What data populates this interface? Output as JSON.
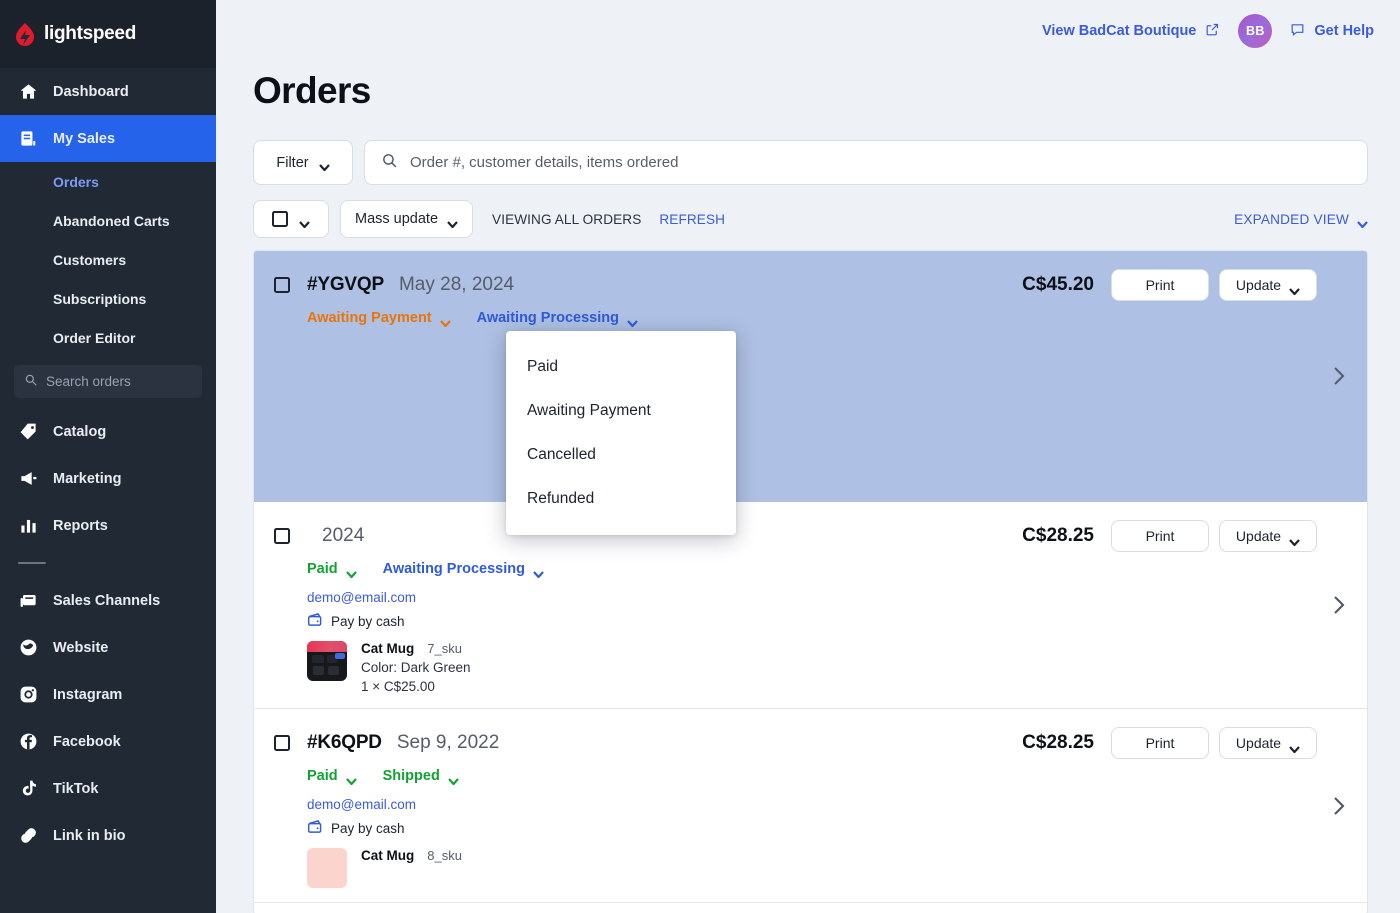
{
  "brand": {
    "name": "lightspeed",
    "logo_icon": "lightspeed-flame-icon"
  },
  "sidebar": {
    "primary": [
      {
        "label": "Dashboard",
        "icon": "home-icon",
        "active": false
      },
      {
        "label": "My Sales",
        "icon": "sales-document-icon",
        "active": true
      }
    ],
    "subnav": [
      {
        "label": "Orders",
        "current": true
      },
      {
        "label": "Abandoned Carts",
        "current": false
      },
      {
        "label": "Customers",
        "current": false
      },
      {
        "label": "Subscriptions",
        "current": false
      },
      {
        "label": "Order Editor",
        "current": false
      }
    ],
    "search_placeholder": "Search orders",
    "secondary": [
      {
        "label": "Catalog",
        "icon": "tag-icon"
      },
      {
        "label": "Marketing",
        "icon": "megaphone-icon"
      },
      {
        "label": "Reports",
        "icon": "bar-chart-icon"
      }
    ],
    "channels": [
      {
        "label": "Sales Channels",
        "icon": "storefront-icon"
      },
      {
        "label": "Website",
        "icon": "globe-icon"
      },
      {
        "label": "Instagram",
        "icon": "instagram-icon"
      },
      {
        "label": "Facebook",
        "icon": "facebook-icon"
      },
      {
        "label": "TikTok",
        "icon": "tiktok-icon"
      },
      {
        "label": "Link in bio",
        "icon": "link-icon"
      }
    ]
  },
  "topbar": {
    "view_store_label": "View BadCat Boutique",
    "view_store_icon": "external-link-icon",
    "avatar_initials": "BB",
    "help_label": "Get Help",
    "help_icon": "chat-bubble-icon"
  },
  "header": {
    "title": "Orders"
  },
  "toolbar": {
    "filter_label": "Filter",
    "search_placeholder": "Order #, customer details, items ordered",
    "search_value": "",
    "search_icon": "search-icon",
    "mass_update_label": "Mass update",
    "viewing_text": "VIEWING ALL ORDERS",
    "refresh_label": "REFRESH",
    "expanded_view_label": "EXPANDED VIEW"
  },
  "payment_status_dropdown": {
    "open": true,
    "options": [
      "Paid",
      "Awaiting Payment",
      "Cancelled",
      "Refunded"
    ]
  },
  "orders": [
    {
      "number": "#YGVQP",
      "date": "May 28, 2024",
      "price": "C$45.20",
      "payment_status": "Awaiting Payment",
      "payment_status_color": "#e8750a",
      "fulfillment_status": "Awaiting Processing",
      "fulfillment_status_color": "#2f5bd6",
      "selected": true,
      "print_label": "Print",
      "update_label": "Update",
      "email": "",
      "payment_method": "",
      "items": []
    },
    {
      "number": "",
      "date": "2024",
      "price": "C$28.25",
      "payment_status": "Paid",
      "payment_status_color": "#12a233",
      "fulfillment_status": "Awaiting Processing",
      "fulfillment_status_color": "#2f5bd6",
      "selected": false,
      "print_label": "Print",
      "update_label": "Update",
      "email": "demo@email.com",
      "payment_method": "Pay by cash",
      "items": [
        {
          "name": "Cat Mug",
          "sku": "7_sku",
          "variant": "Color: Dark Green",
          "qty_price": "1 × C$25.00",
          "thumb": "dark"
        }
      ]
    },
    {
      "number": "#K6QPD",
      "date": "Sep 9, 2022",
      "price": "C$28.25",
      "payment_status": "Paid",
      "payment_status_color": "#12a233",
      "fulfillment_status": "Shipped",
      "fulfillment_status_color": "#12a233",
      "selected": false,
      "print_label": "Print",
      "update_label": "Update",
      "email": "demo@email.com",
      "payment_method": "Pay by cash",
      "items": [
        {
          "name": "Cat Mug",
          "sku": "8_sku",
          "variant": "",
          "qty_price": "",
          "thumb": "pink"
        }
      ]
    }
  ],
  "colors": {
    "accent_blue": "#2563eb",
    "link_blue": "#3b5bdb",
    "selected_row": "#aec0e3",
    "sidebar_bg": "#212934",
    "page_bg": "#eef2f7",
    "status_orange": "#e8750a",
    "status_green": "#12a233"
  }
}
